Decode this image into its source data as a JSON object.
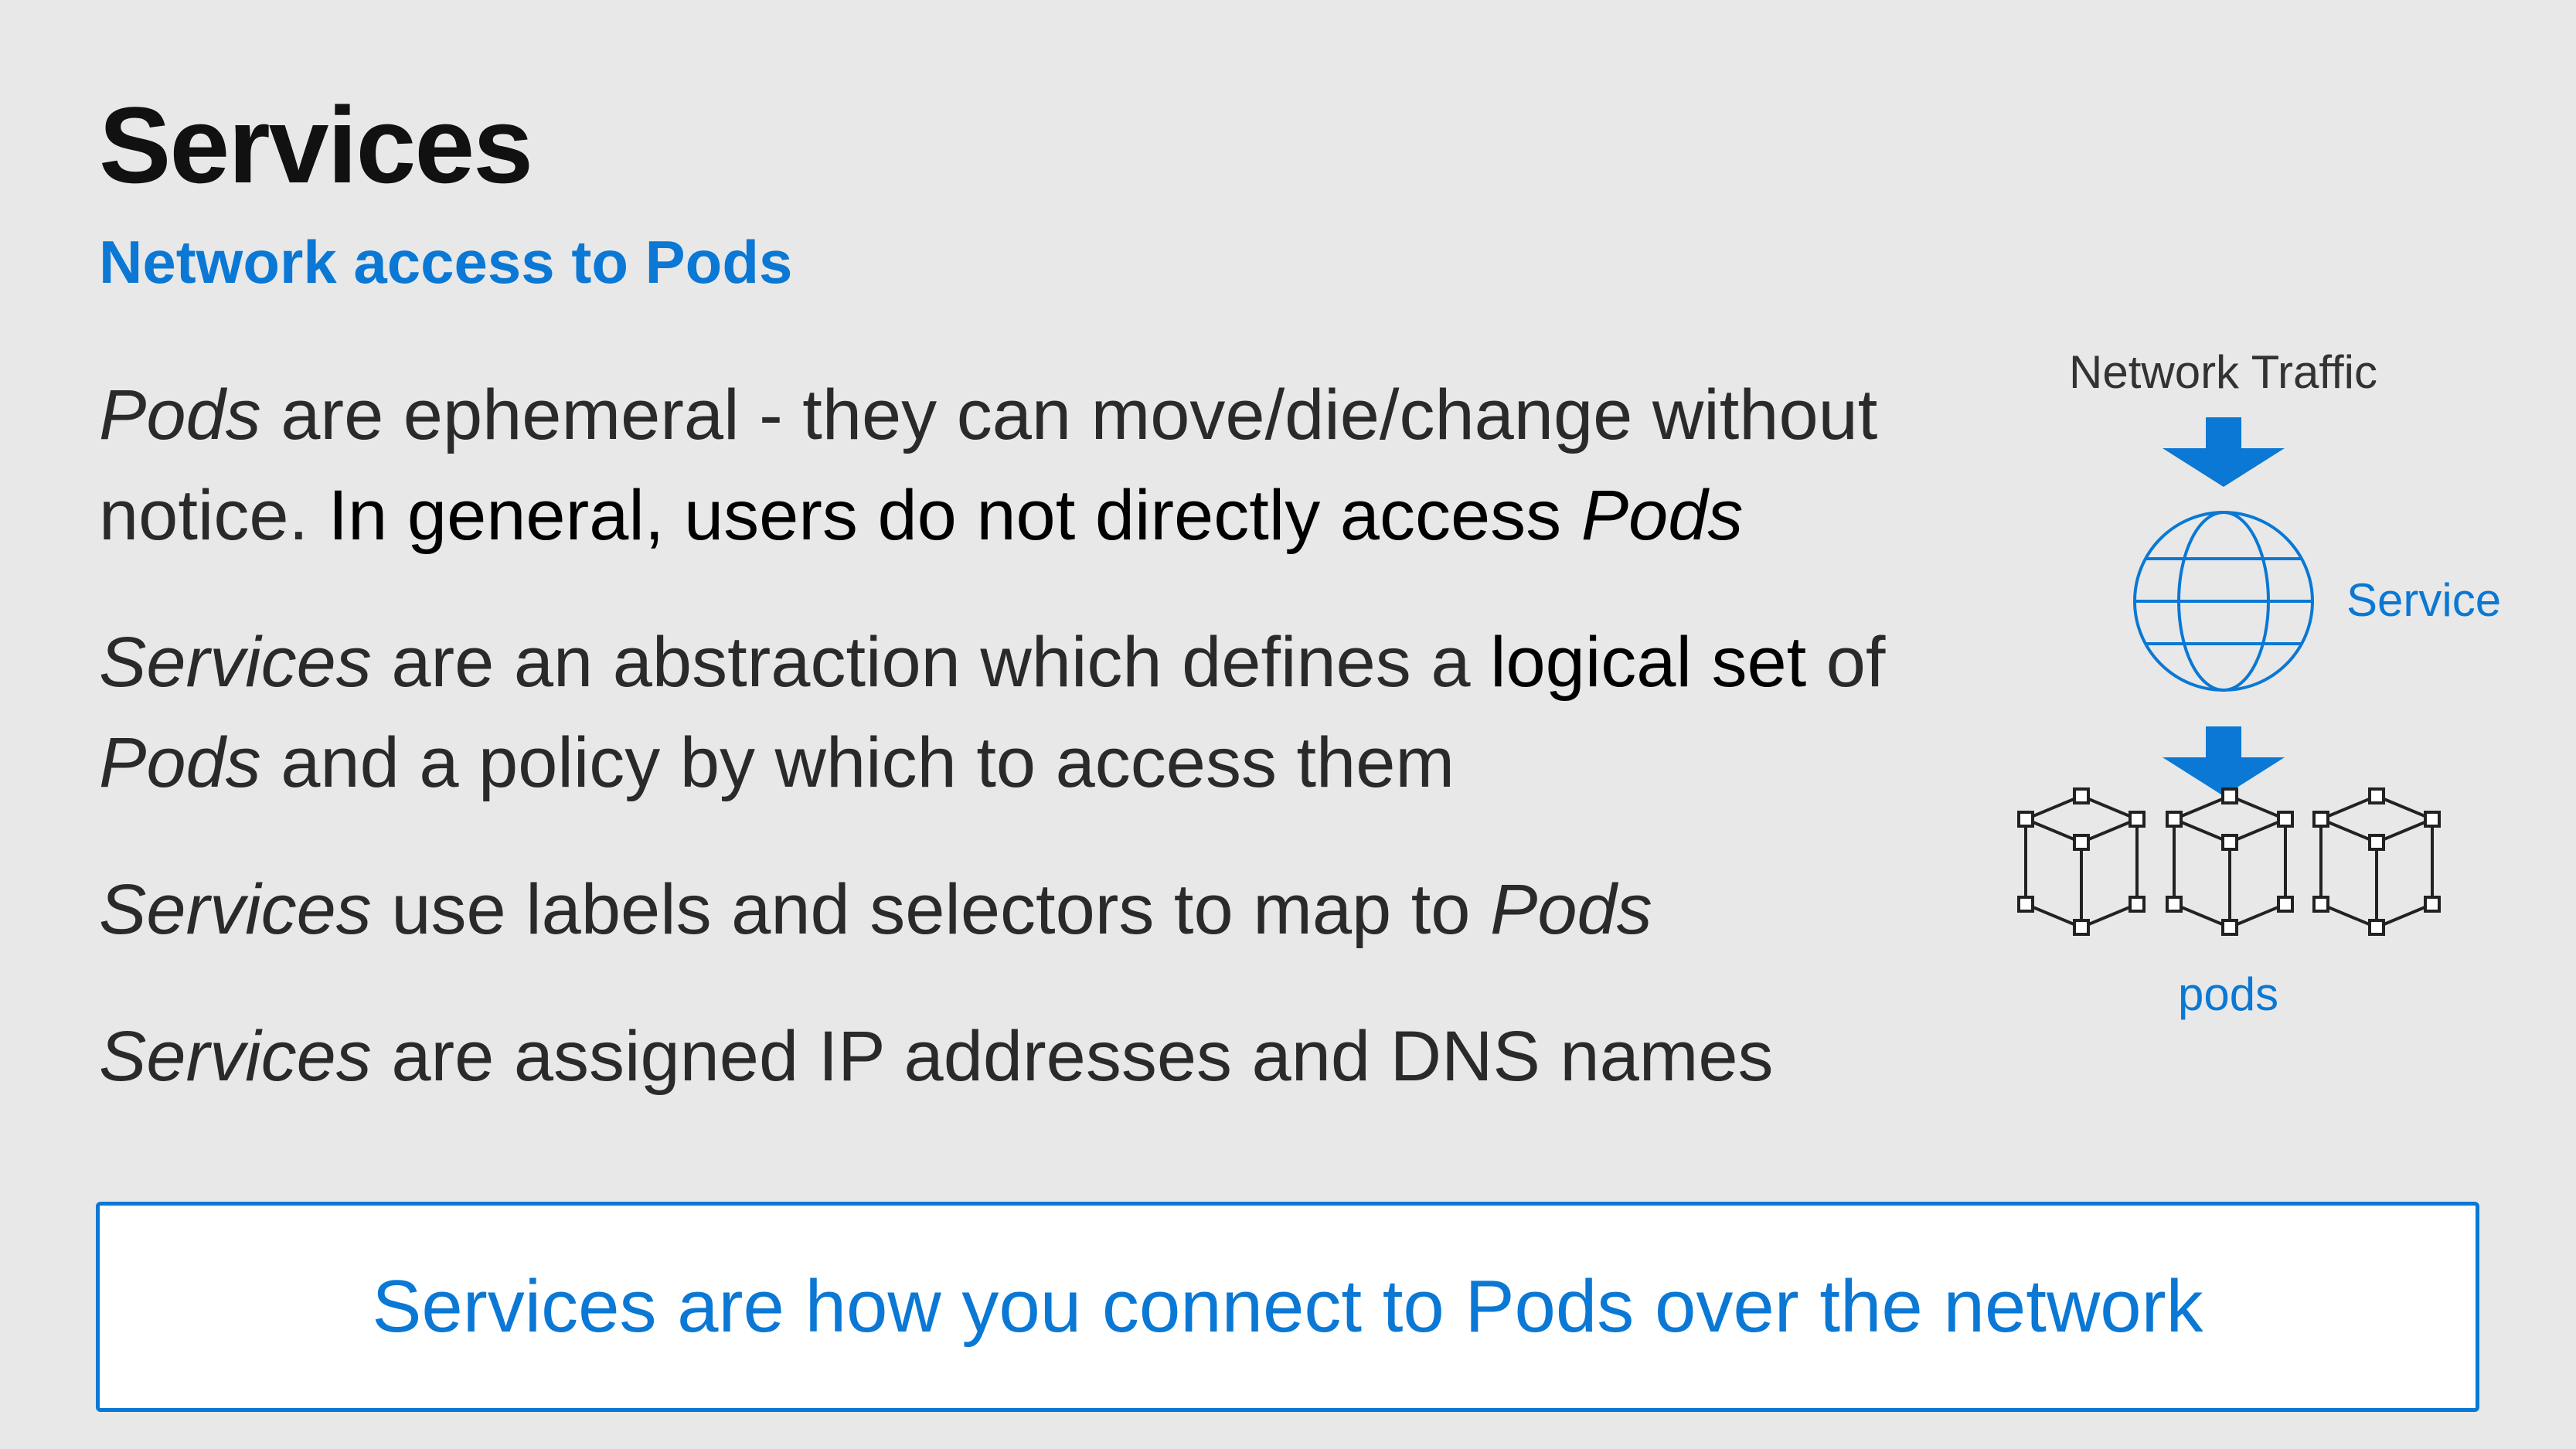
{
  "slide": {
    "title": "Services",
    "subtitle": "Network access to Pods"
  },
  "content": {
    "p1": {
      "em1": "Pods",
      "t1": " are ephemeral - they can move/die/change without notice. ",
      "strong": "In general, users do not directly access ",
      "em2": "Pods"
    },
    "p2": {
      "em1": "Services",
      "t1": " are an abstraction which defines a ",
      "strong": "logical set",
      "t2": " of ",
      "em2": "Pods",
      "t3": " and a policy by which to access them"
    },
    "p3": {
      "em1": "Services",
      "t1": " use labels and selectors to map to ",
      "em2": "Pods"
    },
    "p4": {
      "em1": "Services",
      "t1": " are assigned IP addresses and DNS names"
    }
  },
  "diagram": {
    "traffic_label": "Network Traffic",
    "service_label": "Service",
    "pods_label": "pods",
    "icons": [
      "arrow-down-icon",
      "globe-icon",
      "cube-icon"
    ],
    "accent_color": "#0a78d4"
  },
  "callout": {
    "text": "Services are how you connect to Pods over the network"
  },
  "colors": {
    "background": "#e8e8e8",
    "accent": "#0a78d4",
    "text": "#2a2a2a"
  }
}
